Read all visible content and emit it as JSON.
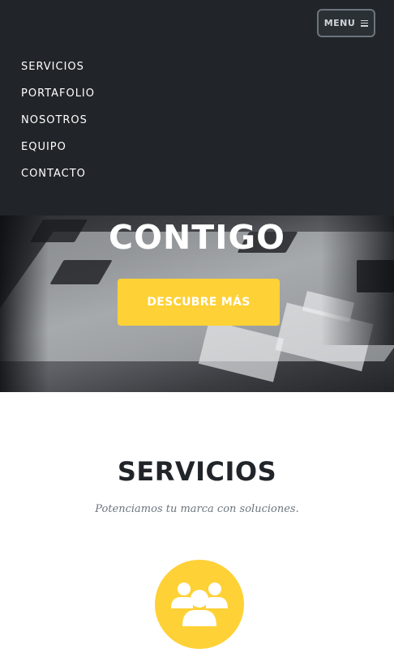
{
  "navbar": {
    "toggle_label": "MENU",
    "toggle_icon": "hamburger-icon",
    "items": [
      {
        "label": "SERVICIOS"
      },
      {
        "label": "PORTAFOLIO"
      },
      {
        "label": "NOSOTROS"
      },
      {
        "label": "EQUIPO"
      },
      {
        "label": "CONTACTO"
      }
    ]
  },
  "hero": {
    "title": "CONTIGO",
    "button_label": "DESCUBRE MÁS"
  },
  "services": {
    "heading": "SERVICIOS",
    "subheading": "Potenciamos tu marca con soluciones.",
    "icon": "users-icon"
  },
  "colors": {
    "nav_background": "#212529",
    "accent": "#fed136",
    "heading": "#212529",
    "muted": "#6c757d"
  }
}
